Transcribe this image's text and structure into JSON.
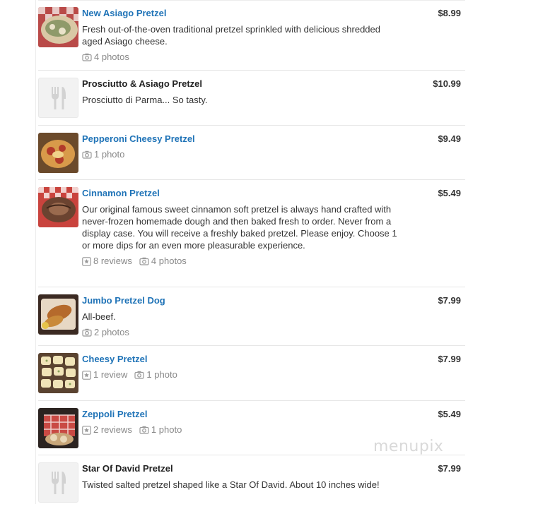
{
  "menu": {
    "items": [
      {
        "name": "New Asiago Pretzel",
        "price": "$8.99",
        "description": "Fresh out-of-the-oven traditional pretzel sprinkled with delicious shredded aged Asiago cheese.",
        "photos": "4 photos"
      },
      {
        "name": "Prosciutto & Asiago Pretzel",
        "price": "$10.99",
        "description": "Prosciutto di Parma... So tasty."
      },
      {
        "name": "Pepperoni Cheesy Pretzel",
        "price": "$9.49",
        "photos": "1 photo"
      },
      {
        "name": "Cinnamon Pretzel",
        "price": "$5.49",
        "description": "Our original famous sweet cinnamon soft pretzel is always hand crafted with never-frozen homemade dough and then baked fresh to order. Never from a display case. You will receive a freshly baked pretzel. Please enjoy. Choose 1 or more dips for an even more pleasurable experience.",
        "reviews": "8 reviews",
        "photos": "4 photos"
      },
      {
        "name": "Jumbo Pretzel Dog",
        "price": "$7.99",
        "description": "All-beef.",
        "photos": "2 photos"
      },
      {
        "name": "Cheesy Pretzel",
        "price": "$7.99",
        "reviews": "1 review",
        "photos": "1 photo"
      },
      {
        "name": "Zeppoli Pretzel",
        "price": "$5.49",
        "reviews": "2 reviews",
        "photos": "1 photo"
      },
      {
        "name": "Star Of David Pretzel",
        "price": "$7.99",
        "description": "Twisted salted pretzel shaped like a Star Of David. About 10 inches wide!"
      }
    ]
  },
  "icons": {
    "camera": "camera-icon",
    "review": "review-star-icon",
    "placeholder": "fork-knife-icon"
  },
  "colors": {
    "link": "#1f73b7",
    "meta": "#888888",
    "divider": "#e6e6e6"
  },
  "watermark": "menupix"
}
